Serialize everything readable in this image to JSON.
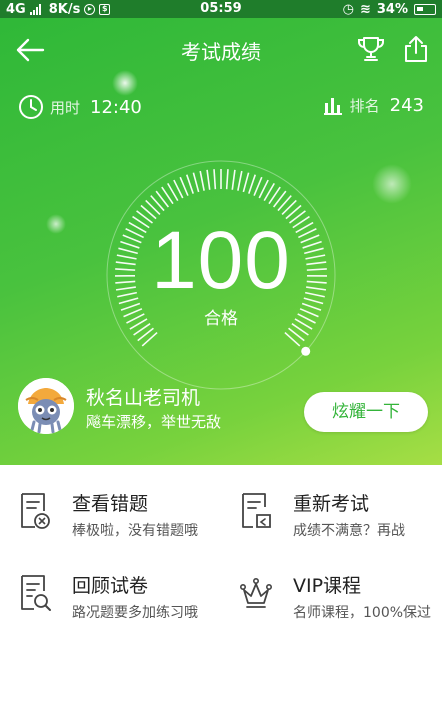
{
  "status_bar": {
    "network": "4G",
    "speed": "8K/s",
    "time": "05:59",
    "battery": "34%"
  },
  "header": {
    "title": "考试成绩",
    "icons": [
      "back-arrow-icon",
      "trophy-icon",
      "share-icon"
    ]
  },
  "stats": {
    "time_label": "用时",
    "time_value": "12:40",
    "rank_label": "排名",
    "rank_value": "243"
  },
  "result": {
    "score": "100",
    "status": "合格",
    "gauge_fraction": 1.0
  },
  "user": {
    "name": "秋名山老司机",
    "motto": "飚车漂移，举世无敌",
    "show_button": "炫耀一下"
  },
  "menu": {
    "items": [
      {
        "title": "查看错题",
        "subtitle": "棒极啦，没有错题哦",
        "icon": "wrong-questions-icon"
      },
      {
        "title": "重新考试",
        "subtitle": "成绩不满意？再战",
        "icon": "retake-exam-icon"
      },
      {
        "title": "回顾试卷",
        "subtitle": "路况题要多加练习哦",
        "icon": "review-paper-icon"
      },
      {
        "title": "VIP课程",
        "subtitle": "名师课程，100%保过",
        "icon": "crown-icon"
      }
    ]
  },
  "colors": {
    "primary_green": "#34b43a",
    "status_bar": "#1f7d2b",
    "gradient_end": "#a6de45"
  }
}
